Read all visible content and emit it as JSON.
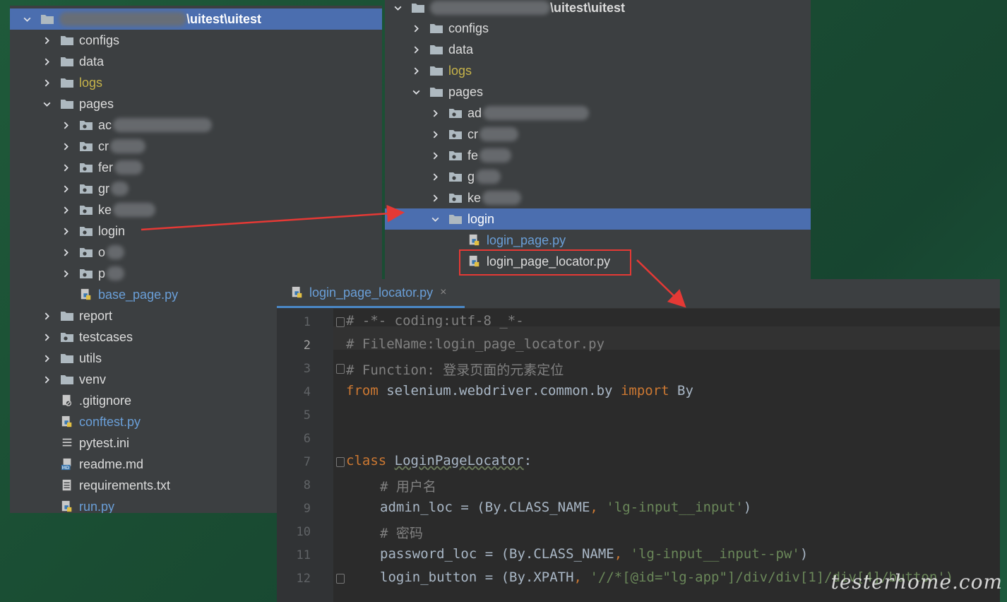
{
  "left_tree": {
    "root_label": "\\uitest\\uitest",
    "items": [
      {
        "label": "configs",
        "type": "folder",
        "state": "collapsed"
      },
      {
        "label": "data",
        "type": "folder",
        "state": "collapsed"
      },
      {
        "label": "logs",
        "type": "folder",
        "state": "collapsed",
        "color": "yellow"
      },
      {
        "label": "pages",
        "type": "folder",
        "state": "expanded"
      },
      {
        "label": "ac",
        "type": "package",
        "state": "collapsed"
      },
      {
        "label": "cr",
        "type": "package",
        "state": "collapsed"
      },
      {
        "label": "fer",
        "type": "package",
        "state": "collapsed"
      },
      {
        "label": "gr",
        "type": "package",
        "state": "collapsed"
      },
      {
        "label": "ke",
        "type": "package",
        "state": "collapsed"
      },
      {
        "label": "login",
        "type": "package",
        "state": "collapsed"
      },
      {
        "label": "o",
        "type": "package",
        "state": "collapsed"
      },
      {
        "label": "p",
        "type": "package",
        "state": "collapsed"
      },
      {
        "label": "base_page.py",
        "type": "python"
      },
      {
        "label": "report",
        "type": "folder",
        "state": "collapsed"
      },
      {
        "label": "testcases",
        "type": "package",
        "state": "collapsed"
      },
      {
        "label": "utils",
        "type": "folder",
        "state": "collapsed"
      },
      {
        "label": "venv",
        "type": "folder",
        "state": "collapsed"
      },
      {
        "label": ".gitignore",
        "type": "gitignore"
      },
      {
        "label": "conftest.py",
        "type": "python"
      },
      {
        "label": "pytest.ini",
        "type": "ini"
      },
      {
        "label": "readme.md",
        "type": "md"
      },
      {
        "label": "requirements.txt",
        "type": "txt"
      },
      {
        "label": "run.py",
        "type": "python"
      }
    ]
  },
  "right_tree": {
    "root_label": "\\uitest\\uitest",
    "items": [
      {
        "label": "configs",
        "type": "folder",
        "state": "collapsed"
      },
      {
        "label": "data",
        "type": "folder",
        "state": "collapsed"
      },
      {
        "label": "logs",
        "type": "folder",
        "state": "collapsed",
        "color": "yellow"
      },
      {
        "label": "pages",
        "type": "folder",
        "state": "expanded"
      },
      {
        "label": "ad",
        "type": "package",
        "state": "collapsed"
      },
      {
        "label": "cr",
        "type": "package",
        "state": "collapsed"
      },
      {
        "label": "fe",
        "type": "package",
        "state": "collapsed"
      },
      {
        "label": "g",
        "type": "package",
        "state": "collapsed"
      },
      {
        "label": "ke",
        "type": "package",
        "state": "collapsed"
      },
      {
        "label": "login",
        "type": "folder",
        "state": "expanded",
        "selected": true
      },
      {
        "label": "login_page.py",
        "type": "python"
      },
      {
        "label": "login_page_locator.py",
        "type": "python",
        "highlighted": true
      }
    ]
  },
  "editor": {
    "tab_label": "login_page_locator.py",
    "tab_close": "×",
    "line_numbers": [
      "1",
      "2",
      "3",
      "4",
      "5",
      "6",
      "7",
      "8",
      "9",
      "10",
      "11",
      "12"
    ],
    "current_line": "2",
    "code": {
      "l1": "# -*- coding:utf-8 _*-",
      "l2": "# FileName:login_page_locator.py",
      "l3": "# Function: 登录页面的元素定位",
      "l4_from": "from",
      "l4_mod": " selenium.webdriver.common.by ",
      "l4_import": "import",
      "l4_name": " By",
      "l7_class": "class",
      "l7_name": "LoginPageLocator",
      "l7_colon": ":",
      "l8": "# 用户名",
      "l9_a": "admin_loc = (By.CLASS_NAME",
      "l9_comma": ", ",
      "l9_str": "'lg-input__input'",
      "l9_end": ")",
      "l10": "# 密码",
      "l11_a": "password_loc = (By.CLASS_NAME",
      "l11_comma": ", ",
      "l11_str": "'lg-input__input--pw'",
      "l11_end": ")",
      "l12_a": "login_button = (By.XPATH",
      "l12_comma": ", ",
      "l12_str": "'//*[@id=\"lg-app\"]/div/div[1]/div[4]/button')"
    }
  },
  "watermark": "testerhome.com",
  "colors": {
    "selection": "#4b6eaf",
    "annotation": "#e53935",
    "tree_bg": "#3c3f41",
    "editor_bg": "#2b2b2b"
  }
}
